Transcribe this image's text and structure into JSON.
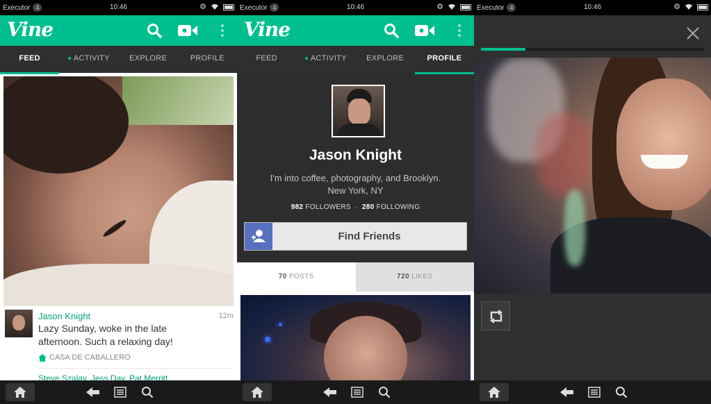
{
  "status_bar": {
    "app": "Executor",
    "notification_count": "4",
    "time": "10:46"
  },
  "app_bar": {
    "logo": "Vine",
    "icons": [
      "search-icon",
      "video-camera-icon",
      "overflow-menu-icon"
    ]
  },
  "tabs": [
    {
      "label": "FEED"
    },
    {
      "label": "ACTIVITY",
      "has_dot": true
    },
    {
      "label": "EXPLORE"
    },
    {
      "label": "PROFILE"
    }
  ],
  "panel1": {
    "active_tab": "FEED"
  },
  "panel2": {
    "active_tab": "PROFILE"
  },
  "feed_post": {
    "author": "Jason Knight",
    "time": "12m",
    "text": "Lazy Sunday, woke in the late afternoon. Such a relaxing day!",
    "location": "CASA DE CABALLERO",
    "likers": "Steve Szalay, Jess Day, Pat Merritt"
  },
  "profile": {
    "name": "Jason Knight",
    "bio_line1": "I'm into coffee, photography, and Brooklyn.",
    "bio_line2": "New York, NY",
    "followers_count": "982",
    "followers_label": "FOLLOWERS",
    "separator": "·",
    "following_count": "280",
    "following_label": "FOLLOWING",
    "find_friends_label": "Find Friends",
    "posts_count": "70",
    "posts_label": "POSTS",
    "likes_count": "720",
    "likes_label": "LIKES"
  },
  "viewer": {
    "progress": 0.2
  },
  "colors": {
    "accent": "#00bf8f",
    "dark": "#2f2f2f",
    "link": "#00a37a",
    "facebook": "#5870c0"
  },
  "nav_bar": {
    "icons": [
      "home-icon",
      "back-icon",
      "menu-icon",
      "search-icon"
    ]
  }
}
